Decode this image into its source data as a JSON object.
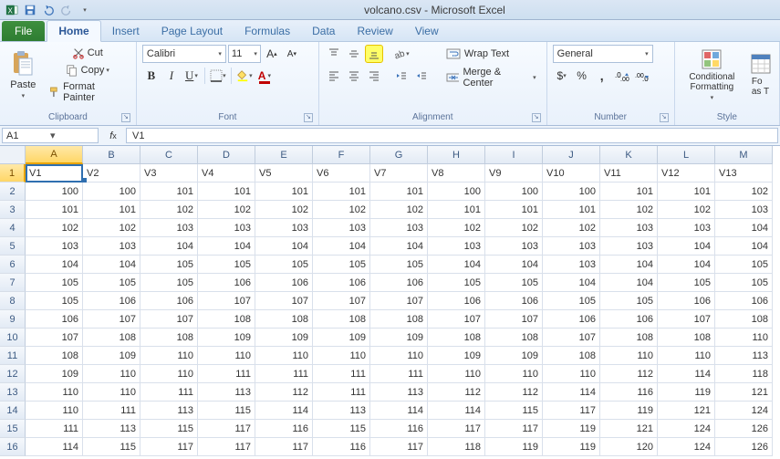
{
  "title": "volcano.csv - Microsoft Excel",
  "tabs": {
    "file": "File",
    "list": [
      "Home",
      "Insert",
      "Page Layout",
      "Formulas",
      "Data",
      "Review",
      "View"
    ],
    "active": 0
  },
  "ribbon": {
    "clipboard": {
      "label": "Clipboard",
      "paste": "Paste",
      "cut": "Cut",
      "copy": "Copy",
      "formatPainter": "Format Painter"
    },
    "font": {
      "label": "Font",
      "name": "Calibri",
      "size": "11"
    },
    "alignment": {
      "label": "Alignment",
      "wrap": "Wrap Text",
      "merge": "Merge & Center"
    },
    "number": {
      "label": "Number",
      "format": "General"
    },
    "styles": {
      "label": "Style",
      "cond": "Conditional Formatting",
      "fmtTable": "Fo\nas T"
    }
  },
  "nameBox": "A1",
  "formula": "V1",
  "columns": [
    "A",
    "B",
    "C",
    "D",
    "E",
    "F",
    "G",
    "H",
    "I",
    "J",
    "K",
    "L",
    "M"
  ],
  "activeCell": {
    "row": 0,
    "col": 0
  },
  "chart_data": {
    "type": "table",
    "headers": [
      "V1",
      "V2",
      "V3",
      "V4",
      "V5",
      "V6",
      "V7",
      "V8",
      "V9",
      "V10",
      "V11",
      "V12",
      "V13"
    ],
    "rows": [
      [
        100,
        100,
        101,
        101,
        101,
        101,
        101,
        100,
        100,
        100,
        101,
        101,
        102
      ],
      [
        101,
        101,
        102,
        102,
        102,
        102,
        102,
        101,
        101,
        101,
        102,
        102,
        103
      ],
      [
        102,
        102,
        103,
        103,
        103,
        103,
        103,
        102,
        102,
        102,
        103,
        103,
        104
      ],
      [
        103,
        103,
        104,
        104,
        104,
        104,
        104,
        103,
        103,
        103,
        103,
        104,
        104
      ],
      [
        104,
        104,
        105,
        105,
        105,
        105,
        105,
        104,
        104,
        103,
        104,
        104,
        105
      ],
      [
        105,
        105,
        105,
        106,
        106,
        106,
        106,
        105,
        105,
        104,
        104,
        105,
        105
      ],
      [
        105,
        106,
        106,
        107,
        107,
        107,
        107,
        106,
        106,
        105,
        105,
        106,
        106
      ],
      [
        106,
        107,
        107,
        108,
        108,
        108,
        108,
        107,
        107,
        106,
        106,
        107,
        108
      ],
      [
        107,
        108,
        108,
        109,
        109,
        109,
        109,
        108,
        108,
        107,
        108,
        108,
        110
      ],
      [
        108,
        109,
        110,
        110,
        110,
        110,
        110,
        109,
        109,
        108,
        110,
        110,
        113
      ],
      [
        109,
        110,
        110,
        111,
        111,
        111,
        111,
        110,
        110,
        110,
        112,
        114,
        118
      ],
      [
        110,
        110,
        111,
        113,
        112,
        111,
        113,
        112,
        112,
        114,
        116,
        119,
        121
      ],
      [
        110,
        111,
        113,
        115,
        114,
        113,
        114,
        114,
        115,
        117,
        119,
        121,
        124
      ],
      [
        111,
        113,
        115,
        117,
        116,
        115,
        116,
        117,
        117,
        119,
        121,
        124,
        126
      ],
      [
        114,
        115,
        117,
        117,
        117,
        116,
        117,
        118,
        119,
        119,
        120,
        124,
        126
      ]
    ]
  }
}
